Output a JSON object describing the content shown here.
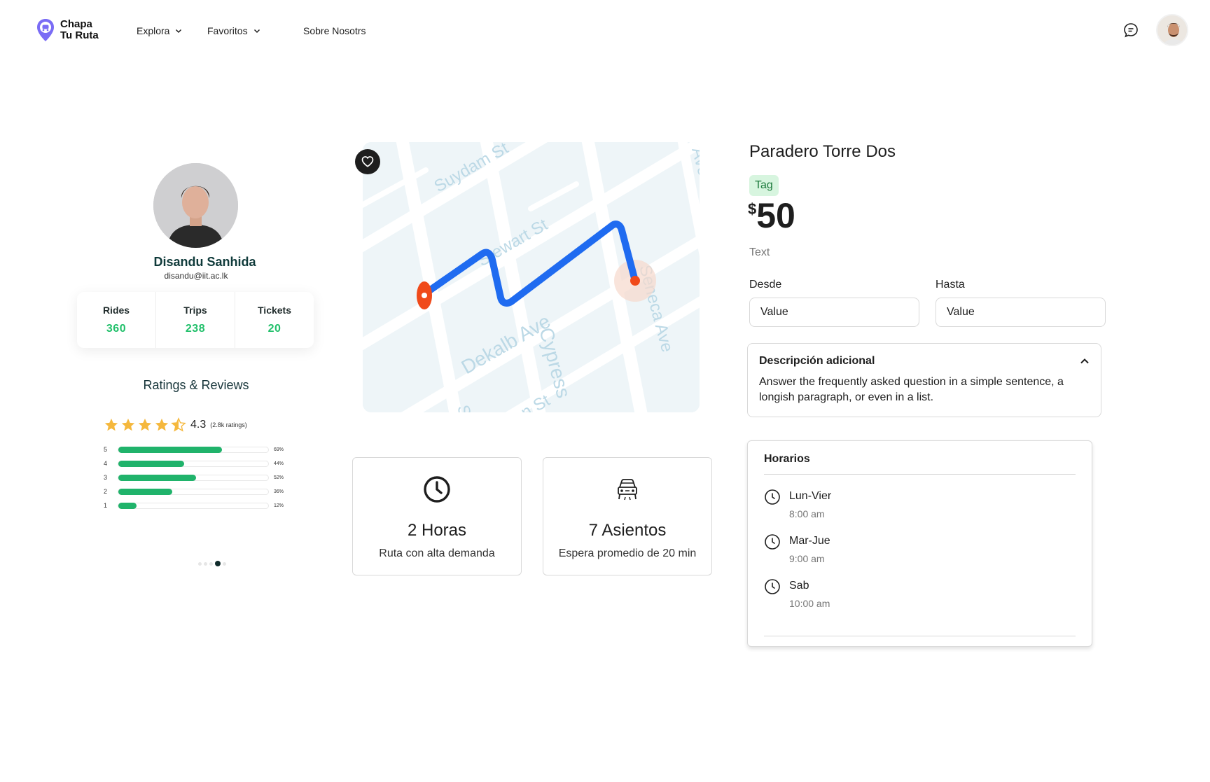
{
  "nav": {
    "logo_line1": "Chapa",
    "logo_line2": "Tu Ruta",
    "explore": "Explora",
    "favorites": "Favoritos",
    "about": "Sobre Nosotrs"
  },
  "profile": {
    "name": "Disandu Sanhida",
    "email": "disandu@iit.ac.lk",
    "stats": [
      {
        "label": "Rides",
        "value": "360"
      },
      {
        "label": "Trips",
        "value": "238"
      },
      {
        "label": "Tickets",
        "value": "20"
      }
    ]
  },
  "ratings": {
    "title": "Ratings & Reviews",
    "average": "4.3",
    "count": "(2.8k ratings)",
    "stars_filled": 4.5,
    "distribution": [
      {
        "stars": "5",
        "percent": 69,
        "label": "69%"
      },
      {
        "stars": "4",
        "percent": 44,
        "label": "44%"
      },
      {
        "stars": "3",
        "percent": 52,
        "label": "52%"
      },
      {
        "stars": "2",
        "percent": 36,
        "label": "36%"
      },
      {
        "stars": "1",
        "percent": 12,
        "label": "12%"
      }
    ],
    "carousel_active_index": 3
  },
  "map": {
    "streets": [
      "Suydam St",
      "Stewart St",
      "Dekalb Ave",
      "Cypress",
      "Seneca Ave",
      "Ave",
      "St",
      "n St"
    ],
    "route_color": "#1f6bf0",
    "marker_color": "#f04a1a"
  },
  "info_cards": [
    {
      "icon": "clock-icon",
      "title": "2 Horas",
      "subtitle": "Ruta con alta demanda"
    },
    {
      "icon": "car-icon",
      "title": "7 Asientos",
      "subtitle": "Espera promedio de 20 min"
    }
  ],
  "stop": {
    "title": "Paradero Torre Dos",
    "tag": "Tag",
    "currency": "$",
    "price": "50",
    "note": "Text",
    "from_label": "Desde",
    "from_value": "Value",
    "to_label": "Hasta",
    "to_value": "Value"
  },
  "accordion": {
    "title": "Descripción adicional",
    "body": "Answer the frequently asked question in a simple sentence, a longish paragraph, or even in a list."
  },
  "schedule": {
    "title": "Horarios",
    "items": [
      {
        "day": "Lun-Vier",
        "time": "8:00 am"
      },
      {
        "day": "Mar-Jue",
        "time": "9:00 am"
      },
      {
        "day": "Sab",
        "time": "10:00 am"
      }
    ]
  },
  "colors": {
    "accent_green": "#22c06b",
    "tag_bg": "#d7f5df",
    "logo_purple": "#6c63ff"
  }
}
